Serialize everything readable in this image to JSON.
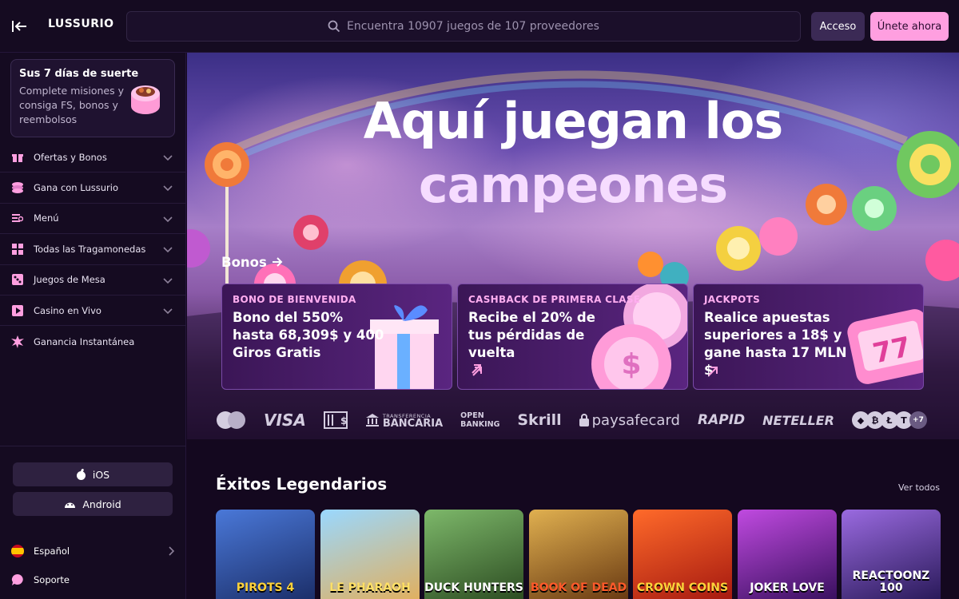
{
  "header": {
    "logo": "LUSSURIO",
    "search_placeholder": "Encuentra 10907 juegos de 107 proveedores",
    "login_label": "Acceso",
    "join_label": "Únete ahora"
  },
  "sidebar": {
    "promo": {
      "title": "Sus 7 días de suerte",
      "text": "Complete misiones y consiga FS, bonos y reembolsos"
    },
    "items": [
      {
        "label": "Ofertas y Bonos",
        "icon": "gift-icon"
      },
      {
        "label": "Gana con Lussurio",
        "icon": "coins-icon"
      },
      {
        "label": "Menú",
        "icon": "menu-icon"
      },
      {
        "label": "Todas las Tragamonedas",
        "icon": "grid-icon"
      },
      {
        "label": "Juegos de Mesa",
        "icon": "dice-icon"
      },
      {
        "label": "Casino en Vivo",
        "icon": "play-icon"
      },
      {
        "label": "Ganancia Instantánea",
        "icon": "burst-icon"
      }
    ],
    "ios_label": "iOS",
    "android_label": "Android",
    "language_label": "Español",
    "support_label": "Soporte"
  },
  "hero": {
    "title_line1": "Aquí juegan los",
    "title_line2": "campeones"
  },
  "bonuses": {
    "heading": "Bonos",
    "cards": [
      {
        "label": "BONO DE BIENVENIDA",
        "text": "Bono del 550% hasta 68,309$ y 400 Giros Gratis"
      },
      {
        "label": "CASHBACK DE PRIMERA CLASE",
        "text": "Recibe el 20% de tus pérdidas de vuelta"
      },
      {
        "label": "JACKPOTS",
        "text": "Realice apuestas superiores a 18$ y gane hasta 17 MLN $"
      }
    ]
  },
  "payments": {
    "visa": "VISA",
    "transfer_small": "TRANSFERENCIA",
    "transfer_big": "BANCARIA",
    "open_banking_1": "OPEN",
    "open_banking_2": "BANKING",
    "skrill": "Skrill",
    "paysafe": "paysafecard",
    "rapid": "RAPID",
    "neteller": "NETELLER",
    "crypto_more": "+7"
  },
  "games": {
    "title": "Éxitos Legendarios",
    "see_all": "Ver todos",
    "items": [
      {
        "name": "PIROTS 4",
        "color": "#2a4da0"
      },
      {
        "name": "LE PHARAOH",
        "color": "#d9a040"
      },
      {
        "name": "DUCK HUNTERS",
        "color": "#3f6e3a"
      },
      {
        "name": "BOOK OF DEAD",
        "color": "#b07a2a"
      },
      {
        "name": "CROWN COINS",
        "color": "#d8401c"
      },
      {
        "name": "JOKER LOVE",
        "color": "#7b2aa3"
      },
      {
        "name": "REACTOONZ 100",
        "color": "#5b2a8a"
      }
    ]
  }
}
